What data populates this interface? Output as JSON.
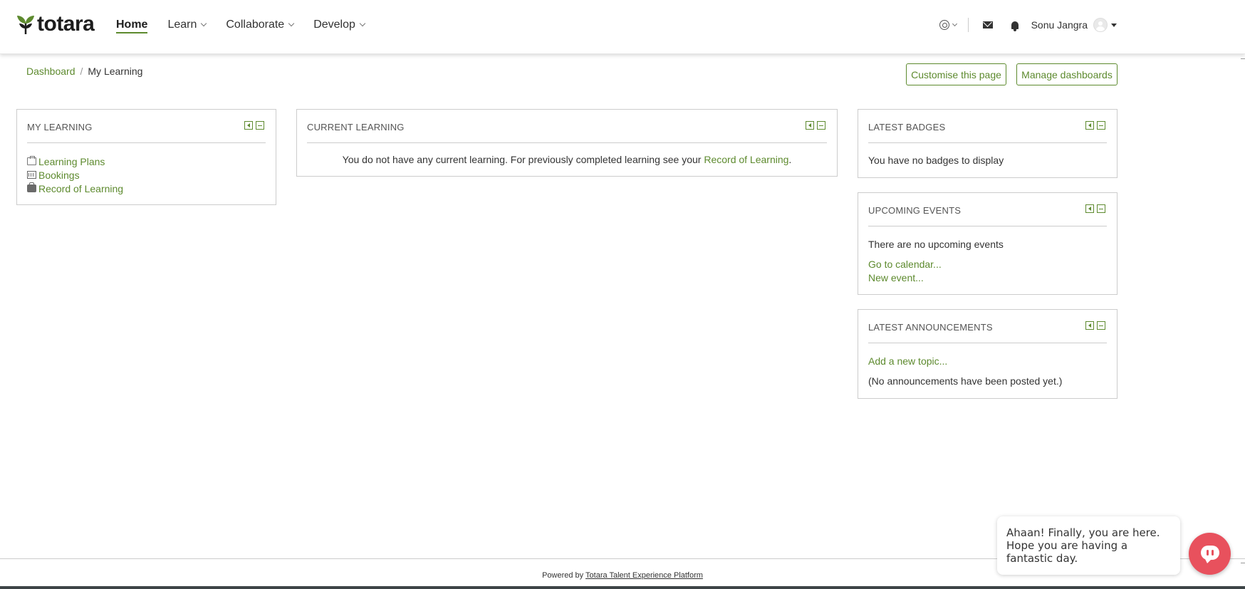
{
  "header": {
    "logo_text": "totara",
    "nav": [
      {
        "label": "Home",
        "active": true
      },
      {
        "label": "Learn",
        "has_dropdown": true
      },
      {
        "label": "Collaborate",
        "has_dropdown": true
      },
      {
        "label": "Develop",
        "has_dropdown": true
      }
    ],
    "user_name": "Sonu Jangra"
  },
  "breadcrumb": {
    "items": [
      "Dashboard",
      "My Learning"
    ]
  },
  "actions": {
    "customise_label": "Customise this page",
    "manage_label": "Manage dashboards"
  },
  "blocks": {
    "my_learning": {
      "title": "MY LEARNING",
      "links": [
        "Learning Plans",
        "Bookings",
        "Record of Learning"
      ]
    },
    "current_learning": {
      "title": "CURRENT LEARNING",
      "message_prefix": "You do not have any current learning. For previously completed learning see your",
      "message_link": "Record of Learning",
      "message_suffix": "."
    },
    "latest_badges": {
      "title": "LATEST BADGES",
      "message": "You have no badges to display"
    },
    "upcoming_events": {
      "title": "UPCOMING EVENTS",
      "message": "There are no upcoming events",
      "links": [
        "Go to calendar...",
        "New event..."
      ]
    },
    "latest_announcements": {
      "title": "LATEST ANNOUNCEMENTS",
      "link": "Add a new topic...",
      "message": "(No announcements have been posted yet.)"
    }
  },
  "footer": {
    "prefix": "Powered by",
    "link": "Totara Talent Experience Platform"
  },
  "chat": {
    "message": "Ahaan! Finally, you are here. Hope you are having a fantastic day."
  },
  "colors": {
    "accent": "#5d8a2e",
    "chat": "#e8515d"
  }
}
